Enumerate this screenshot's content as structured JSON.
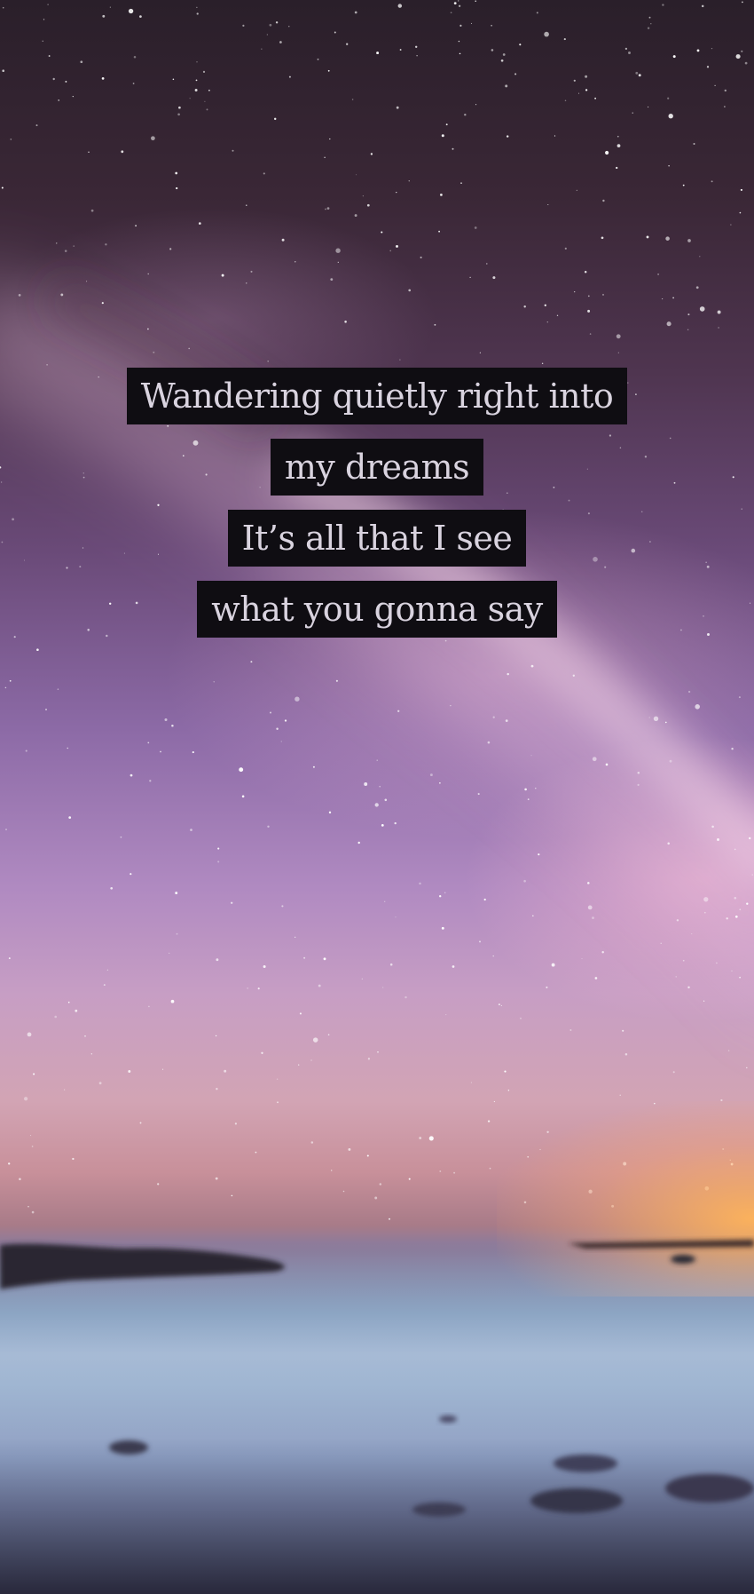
{
  "lyrics": {
    "lines": [
      "Wandering quietly right into",
      "my dreams",
      "It’s all that I see",
      "what you gonna say"
    ],
    "text_color": "#d9d3df",
    "box_color": "#0f0d12"
  },
  "colors": {
    "sky_top": "#2a1f2a",
    "sky_mid": "#8c6aa6",
    "sky_low": "#c79ec4",
    "horizon_glow": "#ffb45a",
    "sea": "#8aa8c3"
  }
}
